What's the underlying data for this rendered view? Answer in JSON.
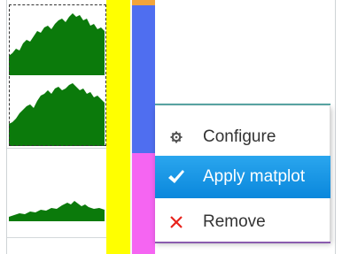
{
  "context_menu": {
    "items": [
      {
        "label": "Configure",
        "icon": "gear-icon",
        "active": false
      },
      {
        "label": "Apply matplot",
        "icon": "checkmark-icon",
        "active": true
      },
      {
        "label": "Remove",
        "icon": "close-x-icon",
        "active": false
      }
    ]
  },
  "colors": {
    "plot_fill": "#0b7a0b",
    "yellow_column": "#ffff00",
    "blue_column": "#4f6ef0",
    "magenta_column": "#f565f2",
    "orange_cap": "#f2a43a",
    "menu_highlight": "#1897e6",
    "remove_icon": "#e8231c",
    "teal_rule": "#5aa8a6",
    "purple_rule": "#8a5cae"
  }
}
